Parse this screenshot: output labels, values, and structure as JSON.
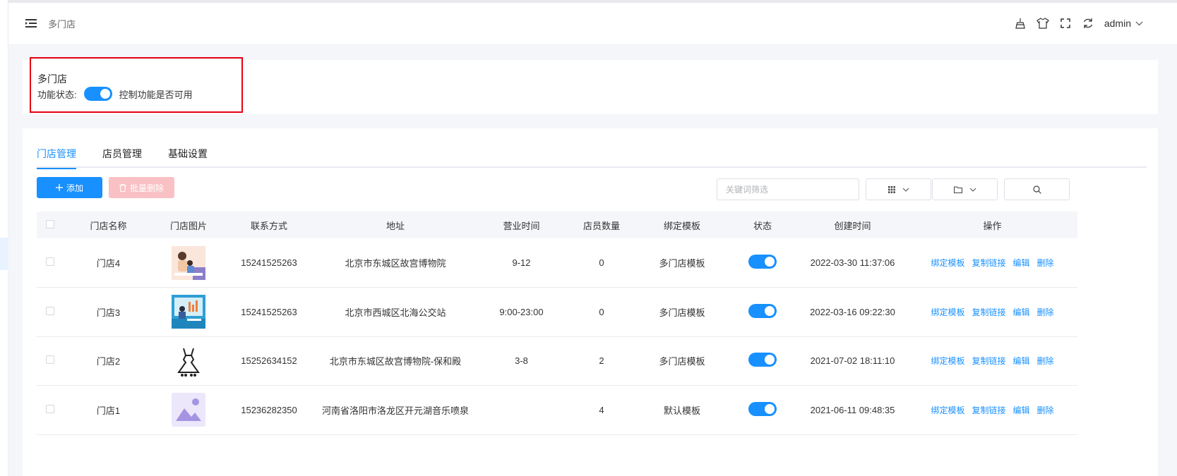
{
  "header": {
    "breadcrumb": "多门店",
    "user": "admin"
  },
  "feature": {
    "title": "多门店",
    "status_label": "功能状态:",
    "status_on": true,
    "status_desc": "控制功能是否可用"
  },
  "tabs": [
    "门店管理",
    "店员管理",
    "基础设置"
  ],
  "toolbar": {
    "add_label": "添加",
    "batch_delete_label": "批量删除",
    "search_placeholder": "关键词筛选"
  },
  "table": {
    "columns": [
      "门店名称",
      "门店图片",
      "联系方式",
      "地址",
      "营业时间",
      "店员数量",
      "绑定模板",
      "状态",
      "创建时间",
      "操作"
    ],
    "actions": [
      "绑定模板",
      "复制链接",
      "编辑",
      "删除"
    ],
    "rows": [
      {
        "name": "门店4",
        "image": "family-photo",
        "phone": "15241525263",
        "address": "北京市东城区故宫博物院",
        "hours": "9-12",
        "staff": "0",
        "template": "多门店模板",
        "enabled": true,
        "created": "2022-03-30 11:37:06"
      },
      {
        "name": "门店3",
        "image": "office-photo",
        "phone": "15241525263",
        "address": "北京市西城区北海公交站",
        "hours": "9:00-23:00",
        "staff": "0",
        "template": "多门店模板",
        "enabled": true,
        "created": "2022-03-16 09:22:30"
      },
      {
        "name": "门店2",
        "image": "dress-icon",
        "phone": "15252634152",
        "address": "北京市东城区故宫博物院-保和殿",
        "hours": "3-8",
        "staff": "2",
        "template": "多门店模板",
        "enabled": true,
        "created": "2021-07-02 18:11:10"
      },
      {
        "name": "门店1",
        "image": "image-placeholder",
        "phone": "15236282350",
        "address": "河南省洛阳市洛龙区开元湖音乐喷泉",
        "hours": "",
        "staff": "4",
        "template": "默认模板",
        "enabled": true,
        "created": "2021-06-11 09:48:35"
      }
    ]
  },
  "colors": {
    "primary": "#1890ff",
    "danger_light": "#f9c1c4",
    "highlight_box": "#e60012"
  }
}
